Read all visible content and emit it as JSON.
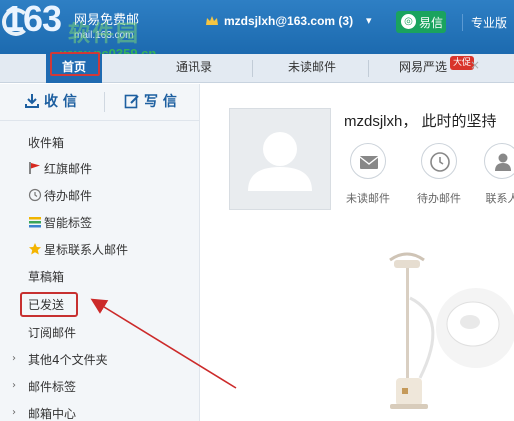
{
  "header": {
    "logo_number": "163",
    "logo_name": "网易免费邮",
    "logo_domain": "mail.163.com",
    "watermark": "软件园",
    "watermark_url": "www.pc0359.cn",
    "account": "mzdsjlxh@163.com",
    "unread_count": "(3)",
    "yixin_label": "易信",
    "pro_label": "专业版"
  },
  "tabs": [
    {
      "label": "首页",
      "active": true
    },
    {
      "label": "通讯录",
      "active": false
    },
    {
      "label": "未读邮件",
      "active": false
    },
    {
      "label": "网易严选",
      "active": false,
      "badge": "大促"
    }
  ],
  "sidebar": {
    "receive_label": "收 信",
    "write_label": "写 信",
    "folders": [
      {
        "label": "收件箱",
        "icon": "inbox"
      },
      {
        "label": "红旗邮件",
        "icon": "red-flag-icon"
      },
      {
        "label": "待办邮件",
        "icon": "clock-icon"
      },
      {
        "label": "智能标签",
        "icon": "tags-icon"
      },
      {
        "label": "星标联系人邮件",
        "icon": "star-icon"
      },
      {
        "label": "草稿箱",
        "icon": ""
      },
      {
        "label": "已发送",
        "icon": ""
      },
      {
        "label": "订阅邮件",
        "icon": ""
      },
      {
        "label": "其他4个文件夹",
        "icon": "",
        "collapsible": true
      },
      {
        "label": "邮件标签",
        "icon": "",
        "collapsible": true
      },
      {
        "label": "邮箱中心",
        "icon": "",
        "collapsible": true
      }
    ]
  },
  "main": {
    "greeting": "mzdsjlxh， 此时的坚持",
    "quick_links": [
      {
        "label": "未读邮件",
        "icon": "envelope-icon"
      },
      {
        "label": "待办邮件",
        "icon": "clock-icon"
      },
      {
        "label": "联系人",
        "icon": "person-icon"
      }
    ]
  },
  "colors": {
    "header_blue": "#1f6ab1",
    "highlight_red": "#c73030",
    "yixin_green": "#1aa35e"
  }
}
